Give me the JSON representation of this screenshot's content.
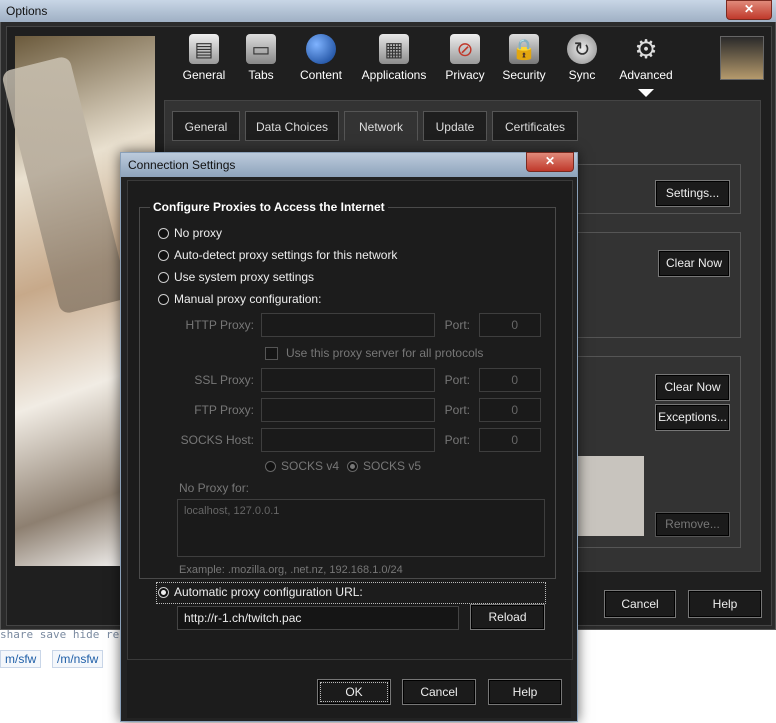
{
  "background": {
    "snippet_text": "share  save  hide  re",
    "links": [
      "m/sfw",
      "/m/nsfw"
    ]
  },
  "options_window": {
    "title": "Options",
    "close_glyph": "✕",
    "toolbar": [
      {
        "label": "General",
        "icon": "general-icon"
      },
      {
        "label": "Tabs",
        "icon": "tabs-icon"
      },
      {
        "label": "Content",
        "icon": "content-icon"
      },
      {
        "label": "Applications",
        "icon": "applications-icon"
      },
      {
        "label": "Privacy",
        "icon": "privacy-icon"
      },
      {
        "label": "Security",
        "icon": "security-icon"
      },
      {
        "label": "Sync",
        "icon": "sync-icon"
      },
      {
        "label": "Advanced",
        "icon": "advanced-icon"
      }
    ],
    "tabs": [
      "General",
      "Data Choices",
      "Network",
      "Update",
      "Certificates"
    ],
    "active_tab": "Network",
    "buttons": {
      "settings": "Settings...",
      "clear_now_1": "Clear Now",
      "clear_now_2": "Clear Now",
      "exceptions": "Exceptions...",
      "remove": "Remove...",
      "cancel": "Cancel",
      "help": "Help"
    }
  },
  "dialog": {
    "title": "Connection Settings",
    "close_glyph": "✕",
    "group_title": "Configure Proxies to Access the Internet",
    "options": {
      "no_proxy": "No proxy",
      "auto_detect": "Auto-detect proxy settings for this network",
      "system": "Use system proxy settings",
      "manual": "Manual proxy configuration:",
      "auto_url": "Automatic proxy configuration URL:"
    },
    "selected_option": "auto_url",
    "manual": {
      "http_label": "HTTP Proxy:",
      "ssl_label": "SSL Proxy:",
      "ftp_label": "FTP Proxy:",
      "socks_label": "SOCKS Host:",
      "port_label": "Port:",
      "port_value": "0",
      "same_proxy_label": "Use this proxy server for all protocols",
      "socks_v4": "SOCKS v4",
      "socks_v5": "SOCKS v5",
      "no_proxy_for_label": "No Proxy for:",
      "no_proxy_for_value": "localhost, 127.0.0.1",
      "example": "Example: .mozilla.org, .net.nz, 192.168.1.0/24"
    },
    "auto_url_value": "http://r-1.ch/twitch.pac",
    "reload": "Reload",
    "ok": "OK",
    "cancel": "Cancel",
    "help": "Help"
  }
}
